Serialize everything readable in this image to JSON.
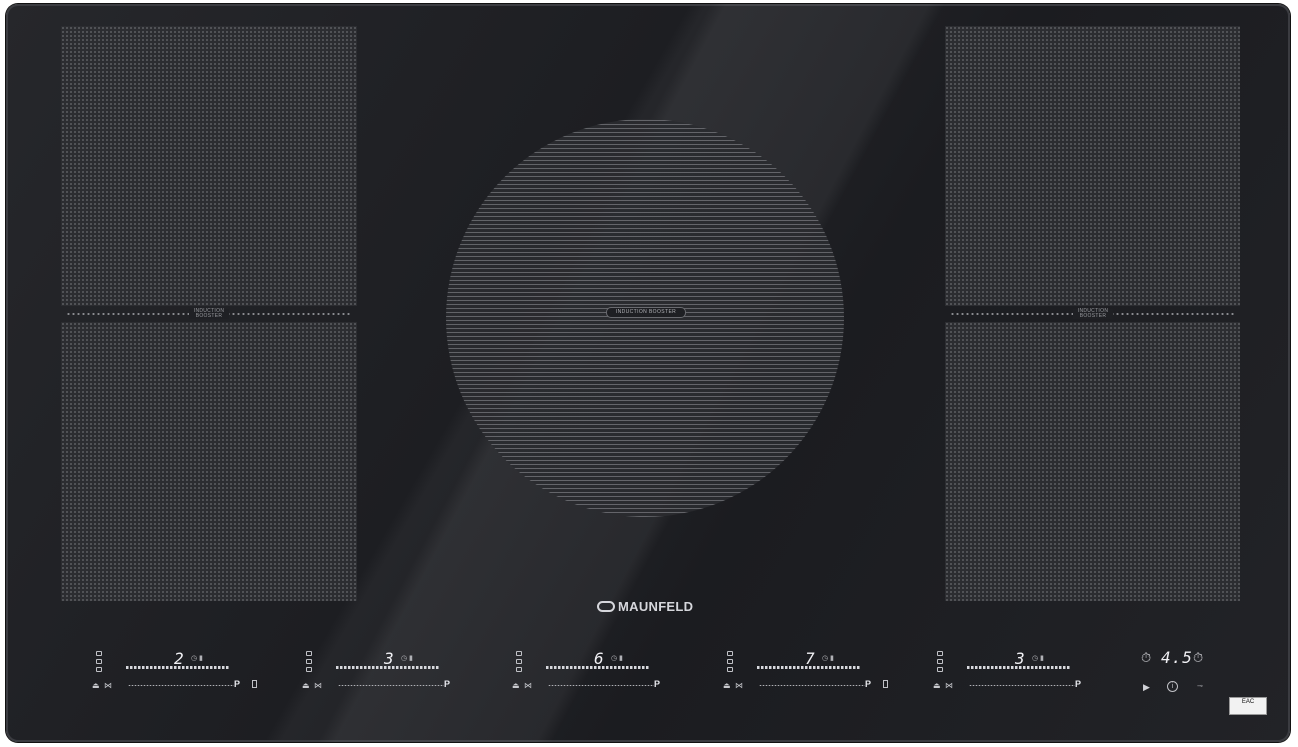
{
  "brand": {
    "name": "MAUNFELD"
  },
  "booster_labels": {
    "left": "INDUCTION BOOSTER",
    "center": "INDUCTION BOOSTER",
    "right": "INDUCTION BOOSTER"
  },
  "zones": [
    {
      "id": "left-flex",
      "level": "2"
    },
    {
      "id": "left-lower",
      "level": "3"
    },
    {
      "id": "center-round",
      "level": "6"
    },
    {
      "id": "right-flex",
      "level": "7"
    },
    {
      "id": "right-lower",
      "level": "3"
    }
  ],
  "power_mark": "P",
  "timer": {
    "value": "4.5"
  },
  "certification_mark": "EAC",
  "icons": [
    "timer-icon",
    "pot-icon",
    "bridge-icon",
    "lock-icon",
    "play-icon",
    "info-icon",
    "key-lock-icon",
    "brand-logo-icon"
  ],
  "colors": {
    "glass": "#1f2024",
    "pattern": "#5a5b60",
    "text": "#e0e1e6"
  }
}
